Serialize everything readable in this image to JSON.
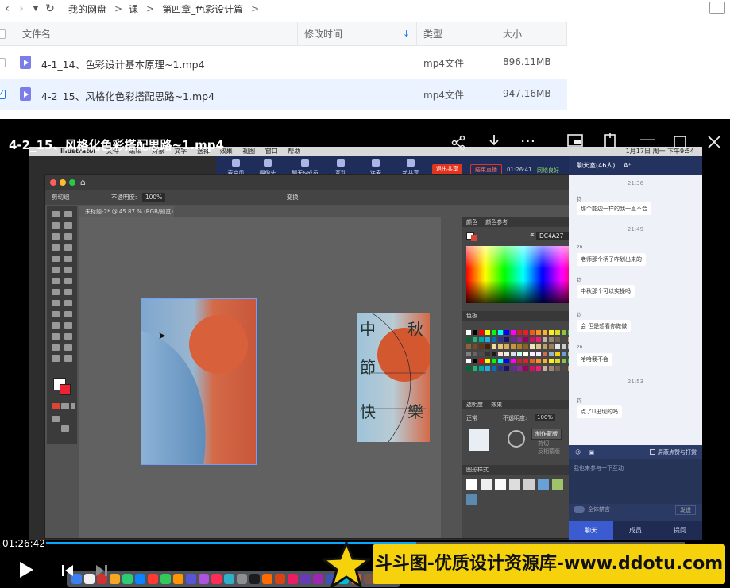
{
  "nav": {
    "breadcrumbs": [
      "我的网盘",
      "课",
      "第四章_色彩设计篇"
    ],
    "separator": ">"
  },
  "table": {
    "columns": [
      "文件名",
      "修改时间",
      "类型",
      "大小"
    ],
    "rows": [
      {
        "name": "4-1_14、色彩设计基本原理~1.mp4",
        "type": "mp4文件",
        "size": "896.11MB",
        "selected": false
      },
      {
        "name": "4-2_15、风格化色彩搭配思路~1.mp4",
        "type": "mp4文件",
        "size": "947.16MB",
        "selected": true
      }
    ]
  },
  "player": {
    "title": "4-2_15、风格化色彩搭配思路~1.mp4",
    "current_time": "01:26:42",
    "progress": 0.58
  },
  "screen": {
    "menubar": [
      "Illustrator",
      "文件",
      "编辑",
      "对象",
      "文字",
      "选择",
      "效果",
      "视图",
      "窗口",
      "帮助"
    ],
    "meeting": {
      "items": [
        "麦克风",
        "摄像头",
        "聊天&成员",
        "互动",
        "连麦",
        "新共享"
      ],
      "exit_share": "退出共享",
      "end_live": "结束直播",
      "time": "01:26:41",
      "network": "网络良好",
      "clock": "1月17日 周一 下午9:54"
    },
    "ai": {
      "control_label": "剪切组",
      "opacity_label": "不透明度:",
      "opacity_value": "100%",
      "transform_label": "变换",
      "doc_tab": "未标题-2* @ 45.87 % (RGB/预览)",
      "artboard_chars": [
        "中",
        "秋",
        "節",
        "快",
        "樂"
      ],
      "panel": {
        "color_tabs": [
          "颜色",
          "颜色参考"
        ],
        "hex": "DC4A27",
        "swatch_tab": "色板",
        "trans_tabs": [
          "透明度",
          "效果"
        ],
        "blend": "正常",
        "trans_opacity_label": "不透明度:",
        "trans_opacity_value": "100%",
        "make_mask": "制作蒙版",
        "clip": "剪切",
        "invert_mask": "反相蒙版",
        "graphic_styles": "图形样式"
      }
    },
    "chat": {
      "title": "聊天室(46人)",
      "messages": [
        {
          "time": "21:36"
        },
        {
          "name": "钧",
          "text": "那个能边一样的我一直不会"
        },
        {
          "time": "21:49"
        },
        {
          "name": "zn",
          "text": "老师那个柄子咋划出来的"
        },
        {
          "name": "钧",
          "text": "中秋那个可以实操吗"
        },
        {
          "name": "钧",
          "text": "会 但是想看你做做"
        },
        {
          "name": "zn",
          "text": "哈哈我不会"
        },
        {
          "time": "21:53"
        },
        {
          "name": "钧",
          "text": "点了U出现的吗"
        }
      ],
      "block_gifts": "屏蔽点赞与打赏",
      "input_placeholder": "我也来参与一下互动",
      "mute_all": "全体禁言",
      "send": "发送",
      "tabs": [
        "聊天",
        "成员",
        "提问"
      ]
    }
  },
  "banner": {
    "text": "斗斗图-优质设计资源库-www.ddotu.com"
  },
  "colors": {
    "accent": "#1677ff",
    "selected_row": "#eaf3ff",
    "banner_bg": "#f5d20c",
    "artboard_orange": "#d45a34",
    "artboard_blue": "#8db3d3",
    "chat_active_tab": "#3a5cd0"
  }
}
